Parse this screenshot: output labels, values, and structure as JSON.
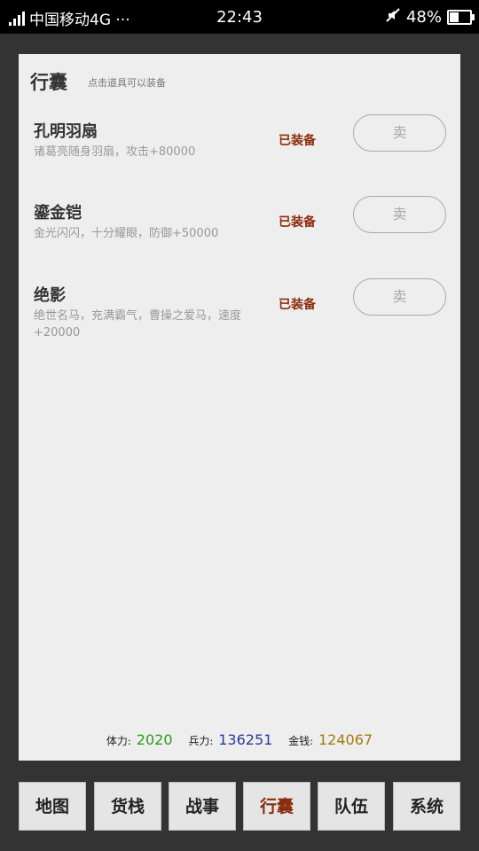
{
  "status_bar": {
    "carrier": "中国移动4G ···",
    "time": "22:43",
    "battery": "48%",
    "battery_level": 0.48
  },
  "panel": {
    "title": "行囊",
    "hint": "点击道具可以装备"
  },
  "items": [
    {
      "name": "孔明羽扇",
      "desc": "诸葛亮随身羽扇，攻击+80000",
      "status": "已装备",
      "sell": "卖"
    },
    {
      "name": "鎏金铠",
      "desc": "金光闪闪，十分耀眼，防御+50000",
      "status": "已装备",
      "sell": "卖"
    },
    {
      "name": "绝影",
      "desc": "绝世名马，充满霸气，曹操之爱马，速度+20000",
      "status": "已装备",
      "sell": "卖"
    }
  ],
  "stats": {
    "stamina_label": "体力:",
    "stamina": "2020",
    "stamina_color": "#2e9a1c",
    "troops_label": "兵力:",
    "troops": "136251",
    "troops_color": "#2b3b99",
    "gold_label": "金钱:",
    "gold": "124067",
    "gold_color": "#a07c10"
  },
  "nav": [
    {
      "label": "地图",
      "active": false
    },
    {
      "label": "货栈",
      "active": false
    },
    {
      "label": "战事",
      "active": false
    },
    {
      "label": "行囊",
      "active": true
    },
    {
      "label": "队伍",
      "active": false
    },
    {
      "label": "系统",
      "active": false
    }
  ]
}
